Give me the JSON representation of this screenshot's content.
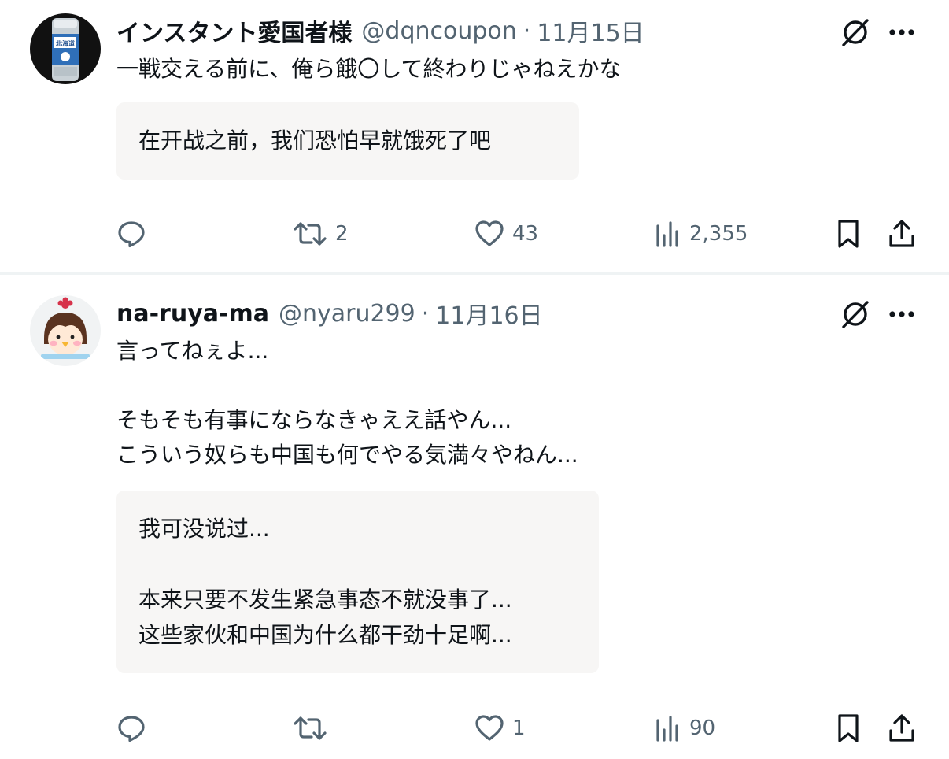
{
  "tweets": [
    {
      "display_name": "インスタント愛国者様",
      "handle": "@dqncoupon",
      "separator": "·",
      "date": "11月15日",
      "text": "一戦交える前に、俺ら餓〇して終わりじゃねえかな",
      "translation": "在开战之前，我们恐怕早就饿死了吧",
      "avatar_label": "北海道",
      "stats": {
        "replies": "",
        "retweets": "2",
        "likes": "43",
        "views": "2,355"
      }
    },
    {
      "display_name": "na-ruya-ma",
      "handle": "@nyaru299",
      "separator": "·",
      "date": "11月16日",
      "text": "言ってねぇよ...\n\nそもそも有事にならなきゃええ話やん...\nこういう奴らも中国も何でやる気満々やねん...",
      "translation": "我可没说过...\n\n本来只要不发生紧急事态不就没事了...\n这些家伙和中国为什么都干劲十足啊...",
      "stats": {
        "replies": "",
        "retweets": "",
        "likes": "1",
        "views": "90"
      }
    }
  ],
  "icons": [
    "grok-icon",
    "more-icon",
    "reply-icon",
    "retweet-icon",
    "like-icon",
    "views-icon",
    "bookmark-icon",
    "share-icon"
  ],
  "colors": {
    "text": "#0f1419",
    "secondary": "#536471",
    "translation_bg": "#f7f6f5",
    "divider": "#eff3f4"
  }
}
